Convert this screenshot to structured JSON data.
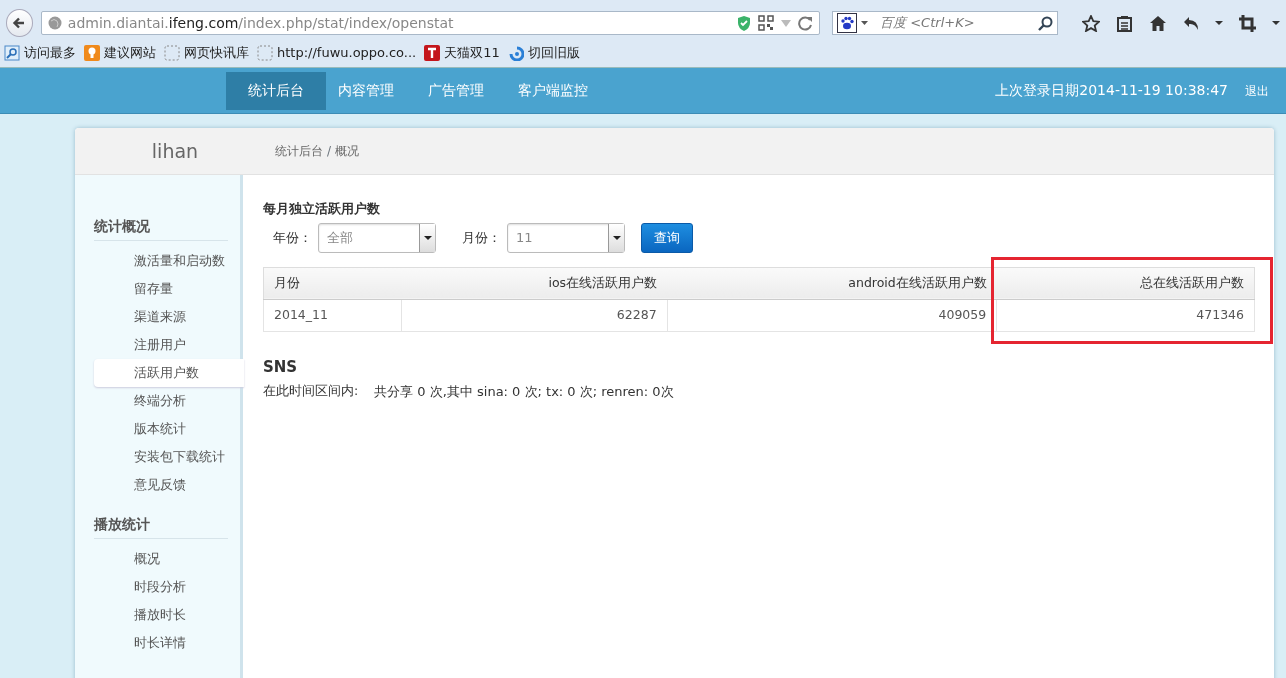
{
  "browser": {
    "url": "admin.diantai.**ifeng.com**/index.php/stat/index/openstat",
    "search": {
      "placeholder": "百度 <Ctrl+K>"
    },
    "bookmarks": [
      {
        "label": "访问最多",
        "kind": "search"
      },
      {
        "label": "建议网站",
        "kind": "bulb"
      },
      {
        "label": "网页快讯库",
        "kind": "blank"
      },
      {
        "label": "http://fuwu.oppo.co...",
        "kind": "blank"
      },
      {
        "label": "天猫双11",
        "kind": "t"
      },
      {
        "label": "切回旧版",
        "kind": "swirl"
      }
    ]
  },
  "navbar": {
    "items": [
      {
        "label": "统计后台",
        "selected": true
      },
      {
        "label": "内容管理",
        "selected": false
      },
      {
        "label": "广告管理",
        "selected": false
      },
      {
        "label": "客户端监控",
        "selected": false
      }
    ],
    "last_login": "上次登录日期2014-11-19 10:38:47",
    "logout": "退出"
  },
  "header": {
    "user": "lihan",
    "breadcrumb": [
      "统计后台",
      "概况"
    ],
    "breadcrumb_separator": "/"
  },
  "sidebar": {
    "sections": [
      {
        "title": "统计概况",
        "items": [
          {
            "label": "激活量和启动数",
            "selected": false
          },
          {
            "label": "留存量",
            "selected": false
          },
          {
            "label": "渠道来源",
            "selected": false
          },
          {
            "label": "注册用户",
            "selected": false
          },
          {
            "label": "活跃用户数",
            "selected": true
          },
          {
            "label": "终端分析",
            "selected": false
          },
          {
            "label": "版本统计",
            "selected": false
          },
          {
            "label": "安装包下载统计",
            "selected": false
          },
          {
            "label": "意见反馈",
            "selected": false
          }
        ]
      },
      {
        "title": "播放统计",
        "items": [
          {
            "label": "概况",
            "selected": false
          },
          {
            "label": "时段分析",
            "selected": false
          },
          {
            "label": "播放时长",
            "selected": false
          },
          {
            "label": "时长详情",
            "selected": false
          }
        ]
      }
    ]
  },
  "main": {
    "title": "每月独立活跃用户数",
    "filters": [
      {
        "label": "年份：",
        "value": "全部"
      },
      {
        "label": "月份：",
        "value": "11"
      }
    ],
    "query_button": "查询",
    "table": {
      "columns": [
        {
          "label": "月份",
          "highlighted": false
        },
        {
          "label": "ios在线活跃用户数",
          "highlighted": false
        },
        {
          "label": "android在线活跃用户数",
          "highlighted": false
        },
        {
          "label": "总在线活跃用户数",
          "highlighted": true
        }
      ],
      "rows": [
        [
          "2014_11",
          "62287",
          "409059",
          "471346"
        ]
      ]
    },
    "sns": {
      "title": "SNS",
      "label": "在此时间区间内:",
      "text": "共分享 0 次,其中 sina: 0 次; tx: 0 次; renren: 0次"
    }
  }
}
